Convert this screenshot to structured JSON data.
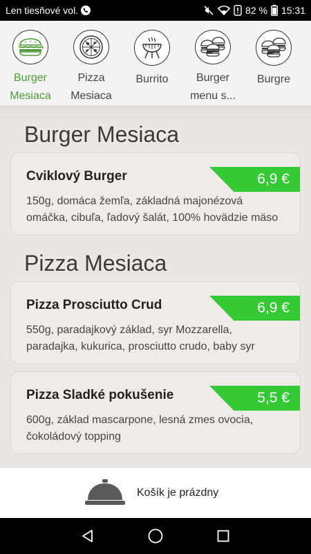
{
  "status_bar": {
    "carrier": "Len tiesňové vol.",
    "battery": "82 %",
    "time": "15:31",
    "icons": [
      "call-icon",
      "mute-icon",
      "wifi-icon",
      "battery-icon"
    ]
  },
  "categories": [
    {
      "label": "Burger Mesiaca",
      "icon": "sandwich-icon",
      "active": true
    },
    {
      "label": "Pizza Mesiaca",
      "icon": "pizza-icon",
      "active": false
    },
    {
      "label": "Burrito",
      "icon": "grill-icon",
      "active": false
    },
    {
      "label": "Burger menu s...",
      "icon": "burgers-icon",
      "active": false
    },
    {
      "label": "Burgre",
      "icon": "burgers-icon",
      "active": false
    }
  ],
  "sections": [
    {
      "title": "Burger Mesiaca",
      "items": [
        {
          "name": "Cviklový Burger",
          "price": "6,9 €",
          "description": "150g, domáca žemľa, základná majonézová omáčka, cibuľa, ľadový šalát, 100% hovädzie mäso"
        }
      ]
    },
    {
      "title": "Pizza Mesiaca",
      "items": [
        {
          "name": "Pizza Prosciutto Crud",
          "price": "6,9 €",
          "description": "550g, paradajkový základ, syr Mozzarella, paradajka, kukurica, prosciutto crudo, baby syr"
        },
        {
          "name": "Pizza Sladké pokušenie",
          "price": "5,5 €",
          "description": "600g, základ mascarpone, lesná zmes ovocia, čokoládový topping"
        }
      ]
    }
  ],
  "cart": {
    "label": "Košík je prázdny",
    "icon": "cloche-icon"
  },
  "nav": {
    "icons": [
      "back-icon",
      "home-icon",
      "recents-icon"
    ]
  },
  "colors": {
    "accent": "#4f9b3b",
    "price_badge": "#36c936",
    "background": "#ebe7e4"
  }
}
